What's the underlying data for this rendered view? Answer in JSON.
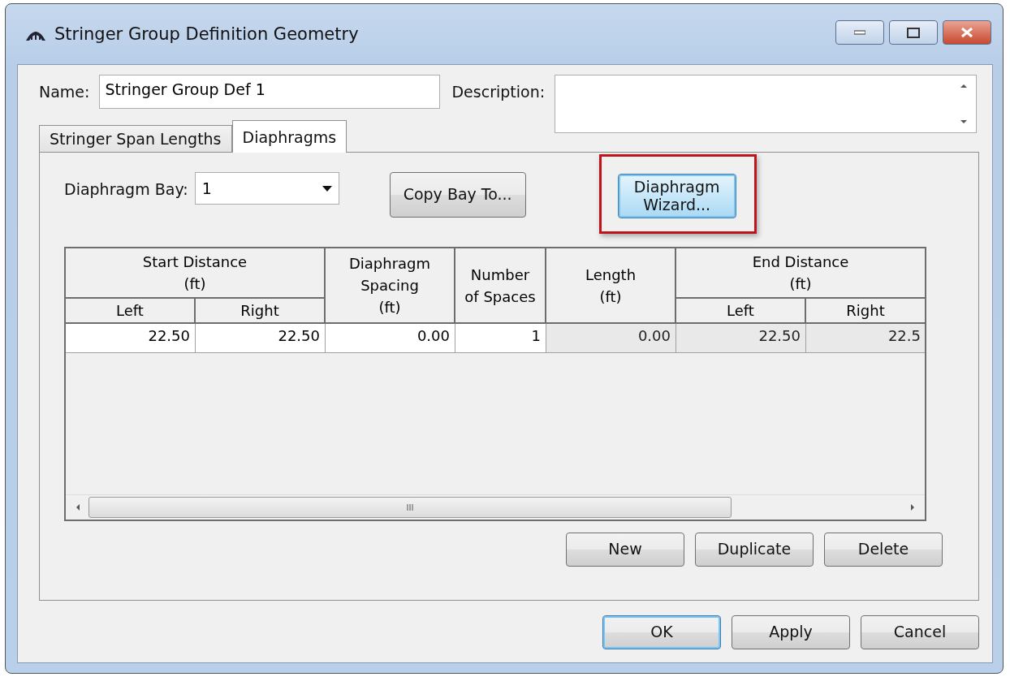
{
  "window": {
    "title": "Stringer Group Definition Geometry"
  },
  "name_field": {
    "label": "Name:",
    "value": "Stringer Group Def 1"
  },
  "description_field": {
    "label": "Description:"
  },
  "tabs": [
    {
      "label": "Stringer Span Lengths",
      "selected": false
    },
    {
      "label": "Diaphragms",
      "selected": true
    }
  ],
  "diaphragm_bay": {
    "label": "Diaphragm Bay:",
    "value": "1"
  },
  "copy_button": "Copy Bay To...",
  "wizard_button": {
    "label": "Diaphragm\nWizard...",
    "highlighted": true
  },
  "table": {
    "column_groups": [
      "Start Distance\n(ft)",
      "End Distance\n(ft)"
    ],
    "columns": [
      {
        "label": "Left",
        "grouped": true
      },
      {
        "label": "Right",
        "grouped": true
      },
      {
        "label": "Diaphragm\nSpacing\n(ft)",
        "grouped": false
      },
      {
        "label": "Number\nof Spaces",
        "grouped": false
      },
      {
        "label": "Length\n(ft)",
        "grouped": false
      },
      {
        "label": "Left",
        "grouped": true
      },
      {
        "label": "Right",
        "grouped": true
      }
    ],
    "rows": [
      [
        {
          "text": "22.50",
          "readonly": false
        },
        {
          "text": "22.50",
          "readonly": false
        },
        {
          "text": "0.00",
          "readonly": false
        },
        {
          "text": "1",
          "readonly": false
        },
        {
          "text": "0.00",
          "readonly": true
        },
        {
          "text": "22.50",
          "readonly": true
        },
        {
          "text": "22.5",
          "readonly": true
        }
      ]
    ]
  },
  "table_buttons": [
    "New",
    "Duplicate",
    "Delete"
  ],
  "dialog_buttons": [
    {
      "label": "OK",
      "default": true
    },
    {
      "label": "Apply",
      "default": false
    },
    {
      "label": "Cancel",
      "default": false
    }
  ]
}
